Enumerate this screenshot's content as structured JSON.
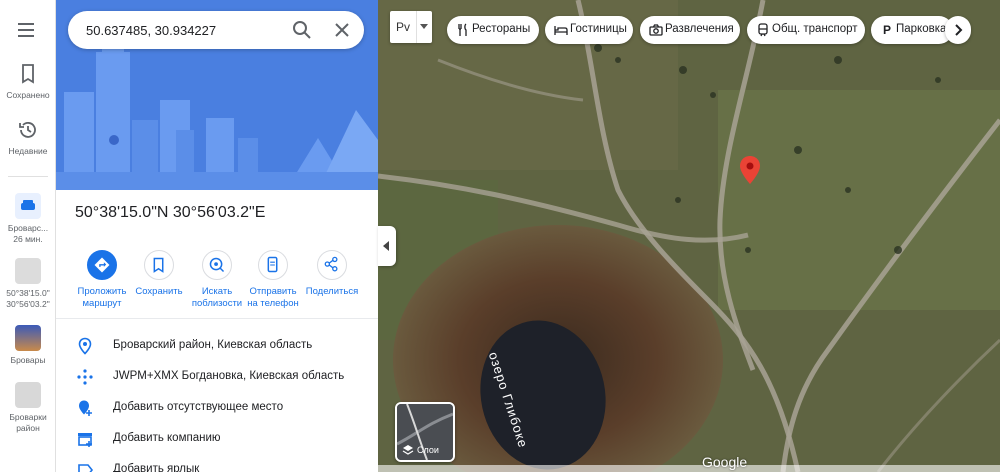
{
  "rail": {
    "saved_label": "Сохранено",
    "recent_label": "Недавние",
    "history": [
      {
        "label": "Броварс...",
        "sublabel": "26 мин."
      },
      {
        "label": "50°38'15.0\"",
        "sublabel": "30°56'03.2\""
      },
      {
        "label": "Бровары",
        "sublabel": ""
      },
      {
        "label": "Броварки",
        "sublabel": "район"
      }
    ]
  },
  "search": {
    "value": "50.637485, 30.934227"
  },
  "place": {
    "title": "50°38'15.0\"N 30°56'03.2\"E"
  },
  "actions": [
    {
      "label1": "Проложить",
      "label2": "маршрут"
    },
    {
      "label1": "Сохранить",
      "label2": ""
    },
    {
      "label1": "Искать",
      "label2": "поблизости"
    },
    {
      "label1": "Отправить",
      "label2": "на телефон"
    },
    {
      "label1": "Поделиться",
      "label2": ""
    }
  ],
  "info_rows": [
    {
      "text": "Броварский район, Киевская область"
    },
    {
      "text": "JWPM+XMX Богдановка, Киевская область"
    },
    {
      "text": "Добавить отсутствующее место"
    },
    {
      "text": "Добавить компанию"
    },
    {
      "text": "Добавить ярлык"
    }
  ],
  "map": {
    "language_label": "Рv",
    "chips": [
      {
        "label": "Рестораны",
        "icon": "fork-knife-icon"
      },
      {
        "label": "Гостиницы",
        "icon": "bed-icon"
      },
      {
        "label": "Развлечения",
        "icon": "camera-icon"
      },
      {
        "label": "Общ. транспорт",
        "icon": "train-icon"
      },
      {
        "label": "Парковка",
        "icon": "parking-icon"
      }
    ],
    "lake_label": "озеро Глибоке",
    "layers_label": "Слои",
    "logo": "Google"
  },
  "colors": {
    "accent": "#1a73e8",
    "pin": "#ea4335",
    "hero": "#4a7fe0"
  }
}
